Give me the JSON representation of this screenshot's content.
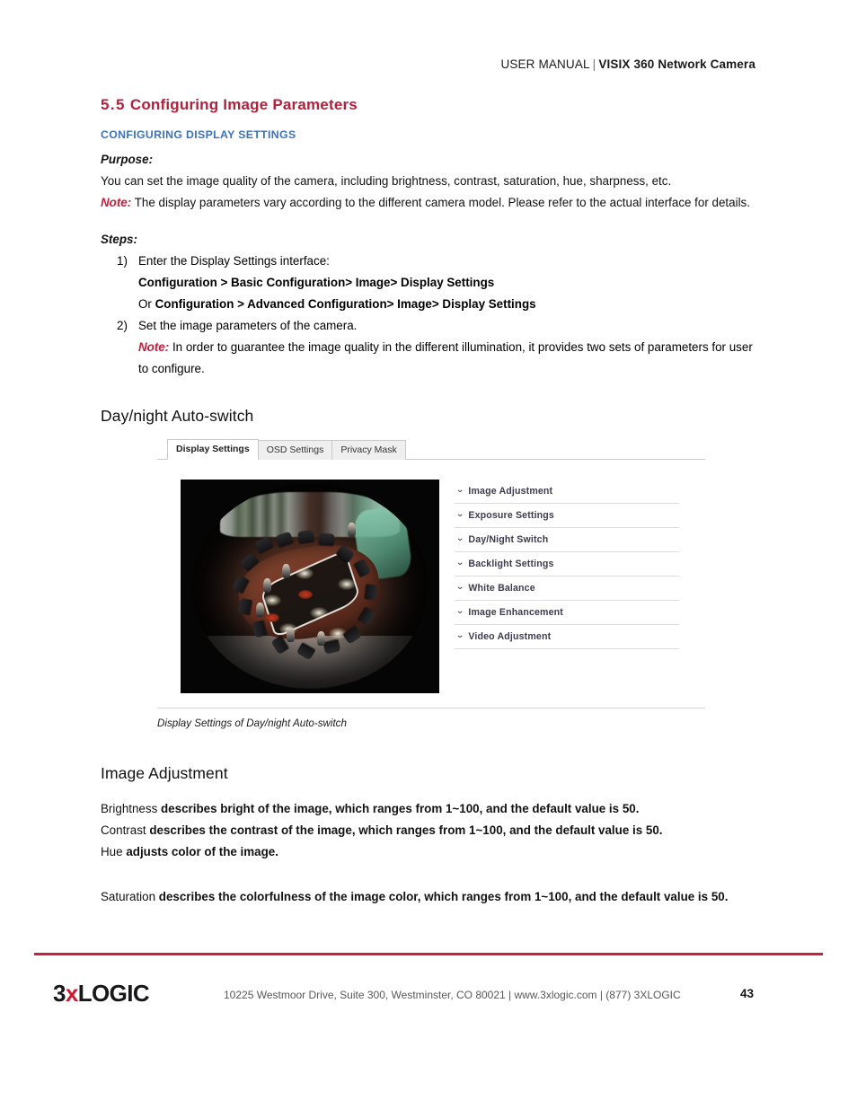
{
  "header": {
    "left": "USER MANUAL",
    "separator": "|",
    "right": "VISIX 360 Network Camera"
  },
  "section": {
    "number": "5.5",
    "title": "Configuring Image Parameters",
    "subtitle": "CONFIGURING DISPLAY SETTINGS",
    "accent_color": "#b4203c",
    "subtitle_color": "#3d72b8"
  },
  "purpose": {
    "label": "Purpose:",
    "text": "You can set the image quality of the camera, including brightness, contrast, saturation, hue, sharpness, etc.",
    "note_label": "Note:",
    "note_text": "The display parameters vary according to the different camera model. Please refer to the actual interface for details."
  },
  "steps": {
    "label": "Steps:",
    "items": [
      {
        "number": "1)",
        "text": "Enter the Display Settings interface:",
        "sub_lines": [
          {
            "prefix": "",
            "bold": "Configuration > Basic Configuration> Image> Display Settings"
          },
          {
            "prefix": "Or ",
            "bold": "Configuration > Advanced Configuration> Image> Display Settings"
          }
        ]
      },
      {
        "number": "2)",
        "text": "Set the image parameters of the camera.",
        "note_label": "Note:",
        "note_text": "In order to guarantee the image quality in the different illumination, it provides two sets of parameters for user to configure."
      }
    ]
  },
  "figure": {
    "heading": "Day/night Auto-switch",
    "caption": "Display Settings of Day/night Auto-switch",
    "tabs": [
      {
        "label": "Display Settings",
        "active": true
      },
      {
        "label": "OSD Settings",
        "active": false
      },
      {
        "label": "Privacy Mask",
        "active": false
      }
    ],
    "preview_alt": "360 degree fisheye live view of a conference room",
    "accordion": [
      {
        "label": "Image Adjustment",
        "icon": "chevron-down-icon"
      },
      {
        "label": "Exposure Settings",
        "icon": "chevron-down-icon"
      },
      {
        "label": "Day/Night Switch",
        "icon": "chevron-down-icon"
      },
      {
        "label": "Backlight Settings",
        "icon": "chevron-down-icon"
      },
      {
        "label": "White Balance",
        "icon": "chevron-down-icon"
      },
      {
        "label": "Image Enhancement",
        "icon": "chevron-down-icon"
      },
      {
        "label": "Video Adjustment",
        "icon": "chevron-down-icon"
      }
    ],
    "chevron_glyph": "⌄"
  },
  "image_adjustment": {
    "heading": "Image Adjustment",
    "params": [
      {
        "term": "Brightness",
        "description": "describes bright of the image, which ranges from 1~100, and the default value is 50."
      },
      {
        "term": "Contrast",
        "description": "describes the contrast of the image, which ranges from 1~100, and the default value is 50."
      },
      {
        "term": "Hue",
        "description": "adjusts color of the image."
      },
      {
        "term": "Saturation",
        "description": "describes the colorfulness of the image color, which ranges from 1~100, and the default value is 50."
      }
    ]
  },
  "footer": {
    "logo_part1": "3",
    "logo_x": "x",
    "logo_part2": "LOGIC",
    "address": "10225 Westmoor Drive, Suite 300, Westminster, CO 80021 | www.3xlogic.com | (877) 3XLOGIC",
    "page_number": "43",
    "rule_color": "#c8203f"
  }
}
